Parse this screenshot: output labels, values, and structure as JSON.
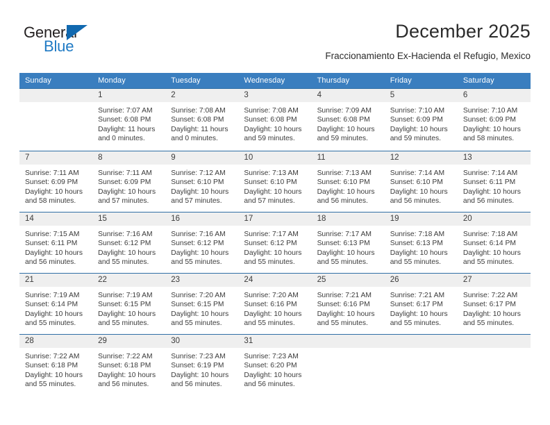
{
  "brand": {
    "name_part1": "General",
    "name_part2": "Blue",
    "triangle_color": "#1169b0",
    "blue_text_color": "#1f7ac4"
  },
  "header": {
    "title": "December 2025",
    "subtitle": "Fraccionamiento Ex-Hacienda el Refugio, Mexico"
  },
  "theme": {
    "header_row_bg": "#3a7ebf",
    "daynum_bg": "#efefef",
    "grid_line": "#2f6ea5",
    "text": "#3b3b3b"
  },
  "weekday_headers": [
    "Sunday",
    "Monday",
    "Tuesday",
    "Wednesday",
    "Thursday",
    "Friday",
    "Saturday"
  ],
  "weeks": [
    [
      {
        "day": "",
        "sunrise": "",
        "sunset": "",
        "daylight_line1": "",
        "daylight_line2": ""
      },
      {
        "day": "1",
        "sunrise": "Sunrise: 7:07 AM",
        "sunset": "Sunset: 6:08 PM",
        "daylight_line1": "Daylight: 11 hours",
        "daylight_line2": "and 0 minutes."
      },
      {
        "day": "2",
        "sunrise": "Sunrise: 7:08 AM",
        "sunset": "Sunset: 6:08 PM",
        "daylight_line1": "Daylight: 11 hours",
        "daylight_line2": "and 0 minutes."
      },
      {
        "day": "3",
        "sunrise": "Sunrise: 7:08 AM",
        "sunset": "Sunset: 6:08 PM",
        "daylight_line1": "Daylight: 10 hours",
        "daylight_line2": "and 59 minutes."
      },
      {
        "day": "4",
        "sunrise": "Sunrise: 7:09 AM",
        "sunset": "Sunset: 6:08 PM",
        "daylight_line1": "Daylight: 10 hours",
        "daylight_line2": "and 59 minutes."
      },
      {
        "day": "5",
        "sunrise": "Sunrise: 7:10 AM",
        "sunset": "Sunset: 6:09 PM",
        "daylight_line1": "Daylight: 10 hours",
        "daylight_line2": "and 59 minutes."
      },
      {
        "day": "6",
        "sunrise": "Sunrise: 7:10 AM",
        "sunset": "Sunset: 6:09 PM",
        "daylight_line1": "Daylight: 10 hours",
        "daylight_line2": "and 58 minutes."
      }
    ],
    [
      {
        "day": "7",
        "sunrise": "Sunrise: 7:11 AM",
        "sunset": "Sunset: 6:09 PM",
        "daylight_line1": "Daylight: 10 hours",
        "daylight_line2": "and 58 minutes."
      },
      {
        "day": "8",
        "sunrise": "Sunrise: 7:11 AM",
        "sunset": "Sunset: 6:09 PM",
        "daylight_line1": "Daylight: 10 hours",
        "daylight_line2": "and 57 minutes."
      },
      {
        "day": "9",
        "sunrise": "Sunrise: 7:12 AM",
        "sunset": "Sunset: 6:10 PM",
        "daylight_line1": "Daylight: 10 hours",
        "daylight_line2": "and 57 minutes."
      },
      {
        "day": "10",
        "sunrise": "Sunrise: 7:13 AM",
        "sunset": "Sunset: 6:10 PM",
        "daylight_line1": "Daylight: 10 hours",
        "daylight_line2": "and 57 minutes."
      },
      {
        "day": "11",
        "sunrise": "Sunrise: 7:13 AM",
        "sunset": "Sunset: 6:10 PM",
        "daylight_line1": "Daylight: 10 hours",
        "daylight_line2": "and 56 minutes."
      },
      {
        "day": "12",
        "sunrise": "Sunrise: 7:14 AM",
        "sunset": "Sunset: 6:10 PM",
        "daylight_line1": "Daylight: 10 hours",
        "daylight_line2": "and 56 minutes."
      },
      {
        "day": "13",
        "sunrise": "Sunrise: 7:14 AM",
        "sunset": "Sunset: 6:11 PM",
        "daylight_line1": "Daylight: 10 hours",
        "daylight_line2": "and 56 minutes."
      }
    ],
    [
      {
        "day": "14",
        "sunrise": "Sunrise: 7:15 AM",
        "sunset": "Sunset: 6:11 PM",
        "daylight_line1": "Daylight: 10 hours",
        "daylight_line2": "and 56 minutes."
      },
      {
        "day": "15",
        "sunrise": "Sunrise: 7:16 AM",
        "sunset": "Sunset: 6:12 PM",
        "daylight_line1": "Daylight: 10 hours",
        "daylight_line2": "and 55 minutes."
      },
      {
        "day": "16",
        "sunrise": "Sunrise: 7:16 AM",
        "sunset": "Sunset: 6:12 PM",
        "daylight_line1": "Daylight: 10 hours",
        "daylight_line2": "and 55 minutes."
      },
      {
        "day": "17",
        "sunrise": "Sunrise: 7:17 AM",
        "sunset": "Sunset: 6:12 PM",
        "daylight_line1": "Daylight: 10 hours",
        "daylight_line2": "and 55 minutes."
      },
      {
        "day": "18",
        "sunrise": "Sunrise: 7:17 AM",
        "sunset": "Sunset: 6:13 PM",
        "daylight_line1": "Daylight: 10 hours",
        "daylight_line2": "and 55 minutes."
      },
      {
        "day": "19",
        "sunrise": "Sunrise: 7:18 AM",
        "sunset": "Sunset: 6:13 PM",
        "daylight_line1": "Daylight: 10 hours",
        "daylight_line2": "and 55 minutes."
      },
      {
        "day": "20",
        "sunrise": "Sunrise: 7:18 AM",
        "sunset": "Sunset: 6:14 PM",
        "daylight_line1": "Daylight: 10 hours",
        "daylight_line2": "and 55 minutes."
      }
    ],
    [
      {
        "day": "21",
        "sunrise": "Sunrise: 7:19 AM",
        "sunset": "Sunset: 6:14 PM",
        "daylight_line1": "Daylight: 10 hours",
        "daylight_line2": "and 55 minutes."
      },
      {
        "day": "22",
        "sunrise": "Sunrise: 7:19 AM",
        "sunset": "Sunset: 6:15 PM",
        "daylight_line1": "Daylight: 10 hours",
        "daylight_line2": "and 55 minutes."
      },
      {
        "day": "23",
        "sunrise": "Sunrise: 7:20 AM",
        "sunset": "Sunset: 6:15 PM",
        "daylight_line1": "Daylight: 10 hours",
        "daylight_line2": "and 55 minutes."
      },
      {
        "day": "24",
        "sunrise": "Sunrise: 7:20 AM",
        "sunset": "Sunset: 6:16 PM",
        "daylight_line1": "Daylight: 10 hours",
        "daylight_line2": "and 55 minutes."
      },
      {
        "day": "25",
        "sunrise": "Sunrise: 7:21 AM",
        "sunset": "Sunset: 6:16 PM",
        "daylight_line1": "Daylight: 10 hours",
        "daylight_line2": "and 55 minutes."
      },
      {
        "day": "26",
        "sunrise": "Sunrise: 7:21 AM",
        "sunset": "Sunset: 6:17 PM",
        "daylight_line1": "Daylight: 10 hours",
        "daylight_line2": "and 55 minutes."
      },
      {
        "day": "27",
        "sunrise": "Sunrise: 7:22 AM",
        "sunset": "Sunset: 6:17 PM",
        "daylight_line1": "Daylight: 10 hours",
        "daylight_line2": "and 55 minutes."
      }
    ],
    [
      {
        "day": "28",
        "sunrise": "Sunrise: 7:22 AM",
        "sunset": "Sunset: 6:18 PM",
        "daylight_line1": "Daylight: 10 hours",
        "daylight_line2": "and 55 minutes."
      },
      {
        "day": "29",
        "sunrise": "Sunrise: 7:22 AM",
        "sunset": "Sunset: 6:18 PM",
        "daylight_line1": "Daylight: 10 hours",
        "daylight_line2": "and 56 minutes."
      },
      {
        "day": "30",
        "sunrise": "Sunrise: 7:23 AM",
        "sunset": "Sunset: 6:19 PM",
        "daylight_line1": "Daylight: 10 hours",
        "daylight_line2": "and 56 minutes."
      },
      {
        "day": "31",
        "sunrise": "Sunrise: 7:23 AM",
        "sunset": "Sunset: 6:20 PM",
        "daylight_line1": "Daylight: 10 hours",
        "daylight_line2": "and 56 minutes."
      },
      {
        "day": "",
        "sunrise": "",
        "sunset": "",
        "daylight_line1": "",
        "daylight_line2": ""
      },
      {
        "day": "",
        "sunrise": "",
        "sunset": "",
        "daylight_line1": "",
        "daylight_line2": ""
      },
      {
        "day": "",
        "sunrise": "",
        "sunset": "",
        "daylight_line1": "",
        "daylight_line2": ""
      }
    ]
  ]
}
